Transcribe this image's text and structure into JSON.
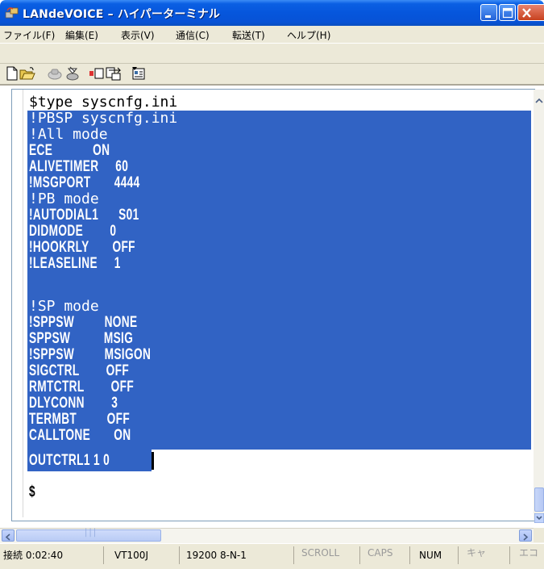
{
  "window": {
    "title": "LANdeVOICE – ハイパーターミナル"
  },
  "menu": {
    "items": [
      "ファイル(F)",
      "編集(E)",
      "表示(V)",
      "通信(C)",
      "転送(T)",
      "ヘルプ(H)"
    ]
  },
  "toolbar": {
    "buttons": [
      "new-icon",
      "open-icon",
      "disconnect-icon",
      "connect-icon",
      "send-icon",
      "receive-icon",
      "properties-icon"
    ]
  },
  "terminal": {
    "command_line": "$type syscnfg.ini",
    "lines": [
      "!PBSP syscnfg.ini",
      "!All mode",
      "ECE            ON",
      "ALIVETIMER     60",
      "!MSGPORT       4444",
      "!PB mode",
      "!AUTODIAL1      S01",
      "DIDMODE        0",
      "!HOOKRLY       OFF",
      "!LEASELINE     1",
      "",
      "!SP mode",
      "!SPPSW         NONE",
      "SPPSW          MSIG",
      "!SPPSW         MSIGON",
      "SIGCTRL        OFF",
      "RMTCTRL        OFF",
      "DLYCONN        3",
      "TERMBT         OFF",
      "CALLTONE       ON",
      "OUTCTRL1 1 0"
    ],
    "prompt": "$",
    "selection_color": "#3163c4"
  },
  "statusbar": {
    "connection": "接続 0:02:40",
    "emulation": "VT100J",
    "settings": "19200 8-N-1",
    "scroll": "SCROLL",
    "caps": "CAPS",
    "num": "NUM",
    "capture": "キャ",
    "echo": "エコ"
  }
}
